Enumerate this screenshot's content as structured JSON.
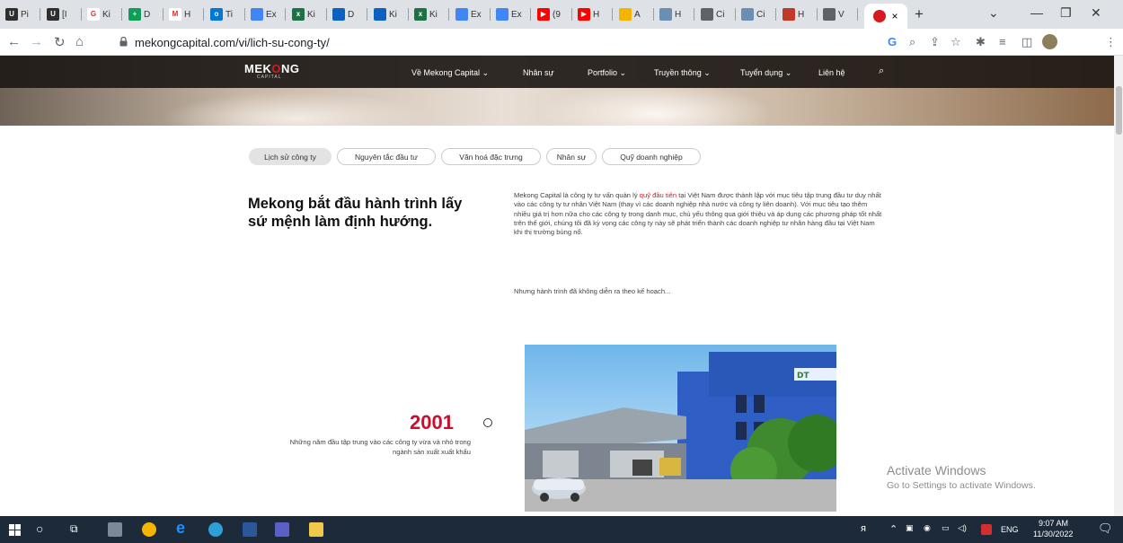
{
  "browser": {
    "tabs": [
      {
        "label": "Pi",
        "fav": "U",
        "color": "#2e2e2e"
      },
      {
        "label": "[I",
        "fav": "U",
        "color": "#2e2e2e"
      },
      {
        "label": "Ki",
        "fav": "G",
        "color": "#ffffff"
      },
      {
        "label": "D",
        "fav": "+",
        "color": "#0f9d58"
      },
      {
        "label": "H",
        "fav": "M",
        "color": "#ffffff"
      },
      {
        "label": "Ti",
        "fav": "o",
        "color": "#0078d4"
      },
      {
        "label": "Ex",
        "fav": "",
        "color": "#4285f4"
      },
      {
        "label": "Ki",
        "fav": "x",
        "color": "#1e7145"
      },
      {
        "label": "D",
        "fav": "",
        "color": "#0b61c1"
      },
      {
        "label": "Ki",
        "fav": "",
        "color": "#0b61c1"
      },
      {
        "label": "Ki",
        "fav": "x",
        "color": "#1e7145"
      },
      {
        "label": "Ex",
        "fav": "",
        "color": "#4285f4"
      },
      {
        "label": "Ex",
        "fav": "",
        "color": "#4285f4"
      },
      {
        "label": "(9",
        "fav": "▶",
        "color": "#ff0000"
      },
      {
        "label": "H",
        "fav": "▶",
        "color": "#ff0000"
      },
      {
        "label": "A",
        "fav": "",
        "color": "#f4b400"
      },
      {
        "label": "H",
        "fav": "",
        "color": "#6b8fb3"
      },
      {
        "label": "Ci",
        "fav": "",
        "color": "#5f6368"
      },
      {
        "label": "Ci",
        "fav": "",
        "color": "#6b8fb3"
      },
      {
        "label": "H",
        "fav": "",
        "color": "#c0392b"
      },
      {
        "label": "V",
        "fav": "",
        "color": "#5f6368"
      }
    ],
    "active_tab_close": "×",
    "new_tab": "+",
    "url": "mekongcapital.com/vi/lich-su-cong-ty/"
  },
  "site": {
    "logo": "MEK",
    "logo_o": "O",
    "logo_end": "NG",
    "logo_sub": "CAPITAL",
    "nav": [
      "Về Mekong Capital",
      "Nhân sự",
      "Portfolio",
      "Truyền thông",
      "Tuyển dụng",
      "Liên hệ"
    ],
    "subnav": [
      "Lịch sử công ty",
      "Nguyên tắc đầu tư",
      "Văn hoá đặc trưng",
      "Nhân sự",
      "Quỹ doanh nghiệp"
    ],
    "headline": "Mekong bắt đầu hành trình lấy sứ mệnh làm định hướng.",
    "intro_before": "Mekong Capital là công ty tư vấn quản lý ",
    "intro_highlight": "quỹ đầu tiên",
    "intro_after": " tại Việt Nam được thành lập với mục tiêu tập trung đầu tư duy nhất vào các công ty tư nhân Việt Nam (thay vì các doanh nghiệp nhà nước và công ty liên doanh). Với mục tiêu tạo thêm nhiều giá trị hơn nữa cho các công ty trong danh mục, chủ yếu thông qua giới thiệu và áp dụng các phương pháp tốt nhất trên thế giới, chúng tôi đã kỳ vọng các công ty này sẽ phát triển thành các doanh nghiệp tư nhân hàng đầu tại Việt Nam khi thị trường bùng nổ.",
    "intro2": "Nhưng hành trình đã không diễn ra theo kế hoạch...",
    "year": "2001",
    "year_desc": "Những năm đầu tập trung vào các công ty vừa và nhỏ trong ngành sản xuất xuất khẩu",
    "photo_sign": "DT"
  },
  "watermark": {
    "line1": "Activate Windows",
    "line2": "Go to Settings to activate Windows."
  },
  "taskbar": {
    "lang": "ENG",
    "time": "9:07 AM",
    "date": "11/30/2022"
  }
}
